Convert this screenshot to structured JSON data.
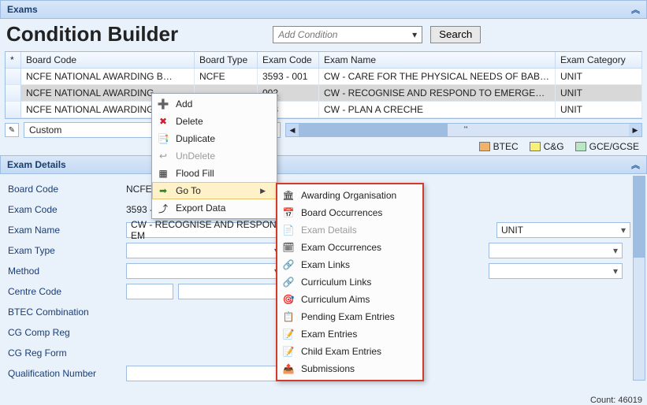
{
  "header": {
    "title": "Exams"
  },
  "builder": {
    "title": "Condition Builder",
    "add_placeholder": "Add Condition",
    "search_label": "Search"
  },
  "grid": {
    "columns": [
      "*",
      "Board Code",
      "Board Type",
      "Exam Code",
      "Exam Name",
      "Exam Category"
    ],
    "rows": [
      {
        "board": "NCFE NATIONAL AWARDING B…",
        "type": "NCFE",
        "code": "3593 - 001",
        "name": "CW - CARE FOR THE PHYSICAL NEEDS OF BABIES & C…",
        "cat": "UNIT"
      },
      {
        "board": "NCFE NATIONAL AWARDING",
        "type": "",
        "code": "002",
        "name": "CW - RECOGNISE AND RESPOND TO EMERGENCIES",
        "cat": "UNIT",
        "selected": true
      },
      {
        "board": "NCFE NATIONAL AWARDING",
        "type": "",
        "code": "003",
        "name": "CW - PLAN A CRECHE",
        "cat": "UNIT"
      }
    ]
  },
  "filter": {
    "mode": "Custom",
    "placeholder": "ype or Select)",
    "tick": "'''"
  },
  "legend": [
    {
      "name": "BTEC",
      "color": "#f3b26a"
    },
    {
      "name": "C&G",
      "color": "#f9f07a"
    },
    {
      "name": "GCE/GCSE",
      "color": "#b8e8c3"
    }
  ],
  "details": {
    "title": "Exam Details",
    "rows": {
      "board_code_label": "Board Code",
      "board_code_value": "NCFE  NCFE",
      "exam_code_label": "Exam Code",
      "exam_code_value": "3593 - 002",
      "exam_name_label": "Exam Name",
      "exam_name_value": "CW - RECOGNISE AND RESPOND TO EM",
      "unit_value": "UNIT",
      "exam_type_label": "Exam Type",
      "method_label": "Method",
      "centre_code_label": "Centre Code",
      "btec_label": "BTEC Combination",
      "cg_comp_label": "CG Comp Reg",
      "cg_form_label": "CG Reg Form",
      "qual_label": "Qualification Number"
    }
  },
  "context_menu": {
    "items": [
      {
        "icon": "➕",
        "icon_name": "add-icon",
        "label": "Add"
      },
      {
        "icon": "✖",
        "icon_name": "delete-icon",
        "label": "Delete",
        "color": "#c23"
      },
      {
        "icon": "📑",
        "icon_name": "duplicate-icon",
        "label": "Duplicate"
      },
      {
        "icon": "↩",
        "icon_name": "undelete-icon",
        "label": "UnDelete",
        "disabled": true
      },
      {
        "icon": "▦",
        "icon_name": "floodfill-icon",
        "label": "Flood Fill"
      },
      {
        "icon": "➡",
        "icon_name": "goto-icon",
        "label": "Go To",
        "hover": true,
        "submenu": true,
        "color": "#2a8a2a"
      },
      {
        "icon": "⤴",
        "icon_name": "export-icon",
        "label": "Export Data"
      }
    ]
  },
  "submenu": {
    "items": [
      {
        "icon": "🏛",
        "label": "Awarding Organisation"
      },
      {
        "icon": "📅",
        "label": "Board Occurrences"
      },
      {
        "icon": "📄",
        "label": "Exam Details",
        "disabled": true
      },
      {
        "icon": "🗓",
        "label": "Exam Occurrences"
      },
      {
        "icon": "🔗",
        "label": "Exam Links"
      },
      {
        "icon": "🔗",
        "label": "Curriculum Links"
      },
      {
        "icon": "🎯",
        "label": "Curriculum Aims"
      },
      {
        "icon": "📋",
        "label": "Pending Exam Entries"
      },
      {
        "icon": "📝",
        "label": "Exam Entries"
      },
      {
        "icon": "📝",
        "label": "Child Exam Entries"
      },
      {
        "icon": "📤",
        "label": "Submissions"
      }
    ]
  },
  "footer": {
    "count_label": "Count: 46019"
  }
}
